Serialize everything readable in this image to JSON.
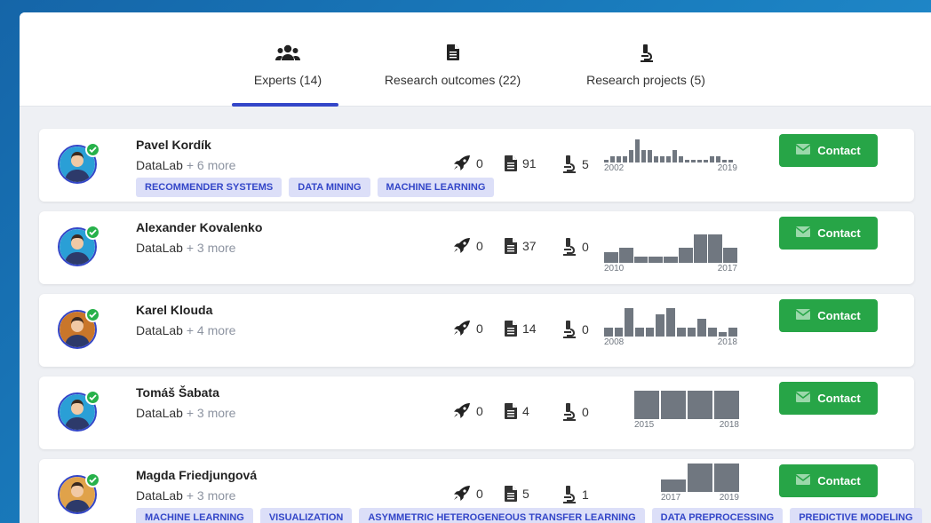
{
  "tabs": [
    {
      "label": "Experts (14)",
      "icon": "users-icon"
    },
    {
      "label": "Research outcomes (22)",
      "icon": "document-icon"
    },
    {
      "label": "Research projects (5)",
      "icon": "microscope-icon"
    }
  ],
  "colors": {
    "accent": "#3346c8",
    "contact_green": "#27a547",
    "badge_green": "#27b14a",
    "tag_bg": "#dcdff8"
  },
  "contact_label": "Contact",
  "experts": [
    {
      "name": "Pavel Kordík",
      "org": "DataLab",
      "more": "+ 6 more",
      "tags": [
        "RECOMMENDER SYSTEMS",
        "DATA MINING",
        "MACHINE LEARNING"
      ],
      "rockets": "0",
      "outcomes": "91",
      "projects": "5",
      "year_start": "2002",
      "year_end": "2019"
    },
    {
      "name": "Alexander Kovalenko",
      "org": "DataLab",
      "more": "+ 3 more",
      "tags": [],
      "rockets": "0",
      "outcomes": "37",
      "projects": "0",
      "year_start": "2010",
      "year_end": "2017"
    },
    {
      "name": "Karel Klouda",
      "org": "DataLab",
      "more": "+ 4 more",
      "tags": [],
      "rockets": "0",
      "outcomes": "14",
      "projects": "0",
      "year_start": "2008",
      "year_end": "2018"
    },
    {
      "name": "Tomáš Šabata",
      "org": "DataLab",
      "more": "+ 3 more",
      "tags": [],
      "rockets": "0",
      "outcomes": "4",
      "projects": "0",
      "year_start": "2015",
      "year_end": "2018"
    },
    {
      "name": "Magda Friedjungová",
      "org": "DataLab",
      "more": "+ 3 more",
      "tags": [
        "MACHINE LEARNING",
        "VISUALIZATION",
        "ASYMMETRIC HETEROGENEOUS TRANSFER LEARNING",
        "DATA PREPROCESSING",
        "PREDICTIVE MODELING"
      ],
      "rockets": "0",
      "outcomes": "5",
      "projects": "1",
      "year_start": "2017",
      "year_end": "2019"
    }
  ]
}
